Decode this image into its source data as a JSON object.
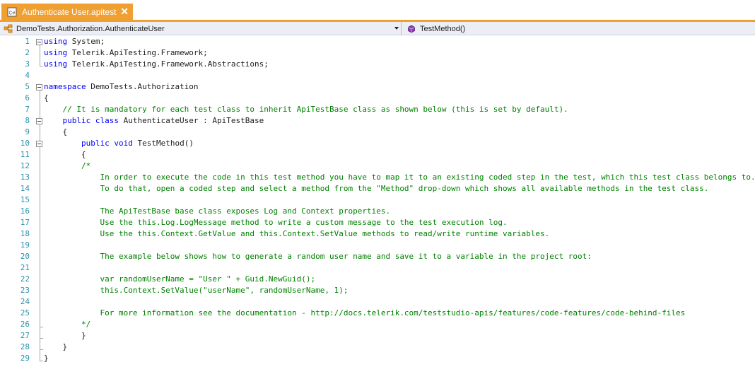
{
  "tab": {
    "title": "Authenticate User.apitest",
    "close_glyph": "✕",
    "accent": "#f0a030"
  },
  "navigation": {
    "type_selector": "DemoTests.Authorization.AuthenticateUser",
    "member_selector": "TestMethod()"
  },
  "editor": {
    "lines": [
      {
        "n": "1",
        "segs": [
          [
            "kw",
            "using"
          ],
          [
            "",
            " System;"
          ]
        ]
      },
      {
        "n": "2",
        "segs": [
          [
            "kw",
            "using"
          ],
          [
            "",
            " Telerik.ApiTesting.Framework;"
          ]
        ]
      },
      {
        "n": "3",
        "segs": [
          [
            "kw",
            "using"
          ],
          [
            "",
            " Telerik.ApiTesting.Framework.Abstractions;"
          ]
        ]
      },
      {
        "n": "4",
        "segs": []
      },
      {
        "n": "5",
        "segs": [
          [
            "kw",
            "namespace"
          ],
          [
            "",
            " DemoTests.Authorization"
          ]
        ]
      },
      {
        "n": "6",
        "segs": [
          [
            "",
            "{"
          ]
        ]
      },
      {
        "n": "7",
        "segs": [
          [
            "cm",
            "    // It is mandatory for each test class to inherit ApiTestBase class as shown below (this is set by default)."
          ]
        ]
      },
      {
        "n": "8",
        "segs": [
          [
            "kw",
            "    public class"
          ],
          [
            "",
            " AuthenticateUser : ApiTestBase"
          ]
        ]
      },
      {
        "n": "9",
        "segs": [
          [
            "",
            "    {"
          ]
        ]
      },
      {
        "n": "10",
        "segs": [
          [
            "kw",
            "        public void"
          ],
          [
            "",
            " TestMethod()"
          ]
        ]
      },
      {
        "n": "11",
        "segs": [
          [
            "",
            "        {"
          ]
        ]
      },
      {
        "n": "12",
        "segs": [
          [
            "cm",
            "        /*"
          ]
        ]
      },
      {
        "n": "13",
        "segs": [
          [
            "cm",
            "            In order to execute the code in this test method you have to map it to an existing coded step in the test, which this test class belongs to."
          ]
        ]
      },
      {
        "n": "14",
        "segs": [
          [
            "cm",
            "            To do that, open a coded step and select a method from the \"Method\" drop-down which shows all available methods in the test class."
          ]
        ]
      },
      {
        "n": "15",
        "segs": []
      },
      {
        "n": "16",
        "segs": [
          [
            "cm",
            "            The ApiTestBase base class exposes Log and Context properties."
          ]
        ]
      },
      {
        "n": "17",
        "segs": [
          [
            "cm",
            "            Use the this.Log.LogMessage method to write a custom message to the test execution log."
          ]
        ]
      },
      {
        "n": "18",
        "segs": [
          [
            "cm",
            "            Use the this.Context.GetValue and this.Context.SetValue methods to read/write runtime variables."
          ]
        ]
      },
      {
        "n": "19",
        "segs": []
      },
      {
        "n": "20",
        "segs": [
          [
            "cm",
            "            The example below shows how to generate a random user name and save it to a variable in the project root:"
          ]
        ]
      },
      {
        "n": "21",
        "segs": []
      },
      {
        "n": "22",
        "segs": [
          [
            "cm",
            "            var randomUserName = \"User \" + Guid.NewGuid();"
          ]
        ]
      },
      {
        "n": "23",
        "segs": [
          [
            "cm",
            "            this.Context.SetValue(\"userName\", randomUserName, 1);"
          ]
        ]
      },
      {
        "n": "24",
        "segs": []
      },
      {
        "n": "25",
        "segs": [
          [
            "cm",
            "            For more information see the documentation - http://docs.telerik.com/teststudio-apis/features/code-features/code-behind-files"
          ]
        ]
      },
      {
        "n": "26",
        "segs": [
          [
            "cm",
            "        */"
          ]
        ]
      },
      {
        "n": "27",
        "segs": [
          [
            "",
            "        }"
          ]
        ]
      },
      {
        "n": "28",
        "segs": [
          [
            "",
            "    }"
          ]
        ]
      },
      {
        "n": "29",
        "segs": [
          [
            "",
            "}"
          ]
        ]
      }
    ]
  }
}
